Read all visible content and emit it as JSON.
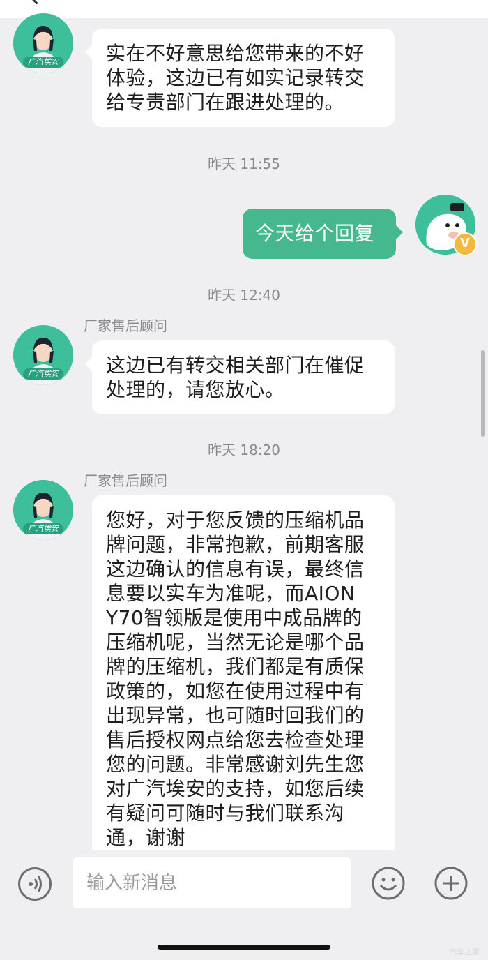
{
  "conversation": {
    "messages": [
      {
        "from": "agent",
        "text": "实在不好意思给您带来的不好体验，这边已有如实记录转交给专责部门在跟进处理的。"
      },
      {
        "time": "昨天 11:55"
      },
      {
        "from": "user",
        "text": "今天给个回复"
      },
      {
        "time": "昨天 12:40"
      },
      {
        "from": "agent",
        "sender": "厂家售后顾问",
        "text": "这边已有转交相关部门在催促处理的，请您放心。"
      },
      {
        "time": "昨天 18:20"
      },
      {
        "from": "agent",
        "sender": "厂家售后顾问",
        "text": "您好，对于您反馈的压缩机品牌问题，非常抱歉，前期客服这边确认的信息有误，最终信息要以实车为准呢，而AION Y70智领版是使用中成品牌的压缩机呢，当然无论是哪个品牌的压缩机，我们都是有质保政策的，如您在使用过程中有出现异常，也可随时回我们的售后授权网点给您去检查处理您的问题。非常感谢刘先生您对广汽埃安的支持，如您后续有疑问可随时与我们联系沟通，谢谢"
      }
    ],
    "agent_avatar_tag": "广汽埃安",
    "user_badge": "V"
  },
  "input": {
    "placeholder": "输入新消息"
  },
  "watermark": "汽车之家",
  "colors": {
    "brand_green": "#46b88e",
    "background": "#efeff2"
  },
  "icons": [
    "back-arrow-icon",
    "agent-avatar",
    "user-avatar",
    "voice-icon",
    "emoji-icon",
    "plus-icon"
  ]
}
